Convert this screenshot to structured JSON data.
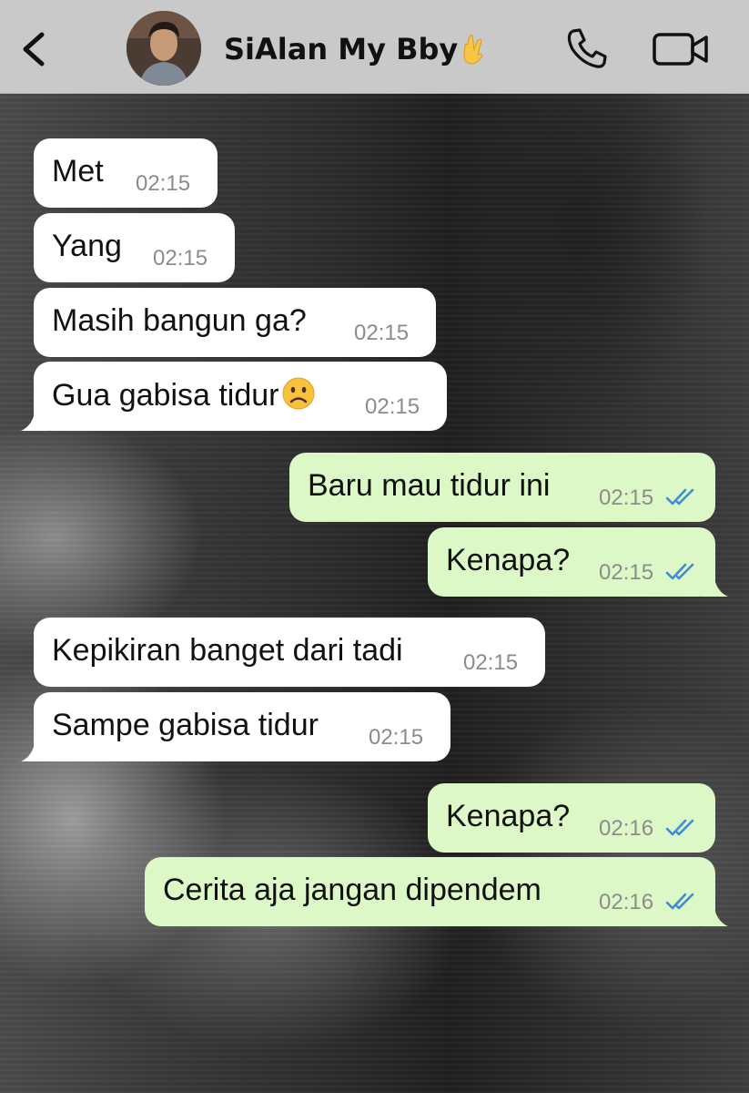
{
  "header": {
    "contact_name": "SiAlan My Bby",
    "name_emoji": "hand-emoji",
    "back_icon": "chevron-left-icon",
    "call_icon": "phone-icon",
    "video_icon": "video-camera-icon",
    "background_color": "#c9c9c9"
  },
  "colors": {
    "incoming_bubble": "#ffffff",
    "outgoing_bubble": "#dcf8c6",
    "read_ticks": "#3d8bd9",
    "timestamp": "#8c8c8c"
  },
  "messages": [
    {
      "direction": "incoming",
      "text": "Met",
      "time": "02:15"
    },
    {
      "direction": "incoming",
      "text": "Yang",
      "time": "02:15"
    },
    {
      "direction": "incoming",
      "text": "Masih bangun ga?",
      "time": "02:15"
    },
    {
      "direction": "incoming",
      "text": "Gua gabisa tidur",
      "emoji": "sad-face-emoji",
      "time": "02:15"
    },
    {
      "direction": "outgoing",
      "text": "Baru mau tidur ini",
      "time": "02:15",
      "status": "read"
    },
    {
      "direction": "outgoing",
      "text": "Kenapa?",
      "time": "02:15",
      "status": "read"
    },
    {
      "direction": "incoming",
      "text": "Kepikiran banget dari tadi",
      "time": "02:15"
    },
    {
      "direction": "incoming",
      "text": "Sampe gabisa tidur",
      "time": "02:15"
    },
    {
      "direction": "outgoing",
      "text": "Kenapa?",
      "time": "02:16",
      "status": "read"
    },
    {
      "direction": "outgoing",
      "text": "Cerita aja jangan dipendem",
      "time": "02:16",
      "status": "read"
    }
  ]
}
